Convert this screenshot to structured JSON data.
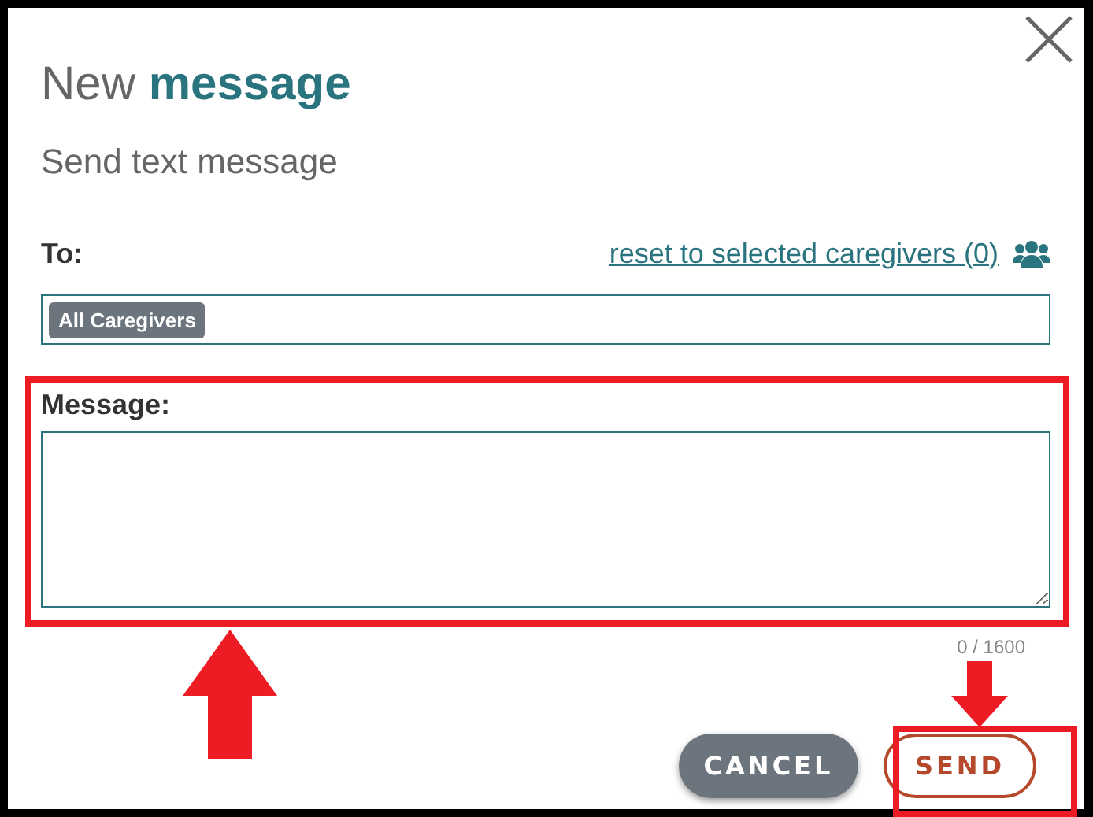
{
  "dialog": {
    "title": "New **message**",
    "subtitle": "Send text message"
  },
  "to": {
    "label": "To:",
    "reset_link": "reset to selected caregivers (0)",
    "chips": [
      "All Caregivers"
    ]
  },
  "message": {
    "label": "Message:",
    "counter": "0 / 1600"
  },
  "buttons": [
    {
      "label": "CANCEL",
      "kind": "secondary"
    },
    {
      "label": "SEND",
      "kind": "primary"
    }
  ]
}
